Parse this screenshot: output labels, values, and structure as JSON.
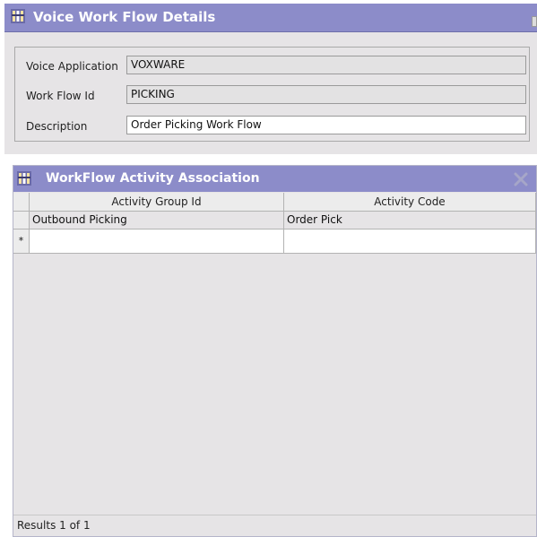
{
  "details_panel": {
    "title": "Voice Work Flow Details",
    "fields": [
      {
        "label": "Voice Application",
        "value": "VOXWARE"
      },
      {
        "label": "Work Flow Id",
        "value": "PICKING"
      },
      {
        "label": "Description",
        "value": "Order Picking Work Flow"
      }
    ]
  },
  "activity_panel": {
    "title": "WorkFlow Activity Association",
    "columns": [
      "Activity Group Id",
      "Activity Code"
    ],
    "rows": [
      {
        "activity_group_id": "Outbound Picking",
        "activity_code": "Order Pick"
      }
    ],
    "new_row_marker": "*",
    "status": "Results  1 of  1"
  },
  "colors": {
    "titlebar": "#8c8cc9",
    "panel_bg": "#e6e4e6"
  },
  "icons": [
    "workflow-app-icon",
    "close-icon"
  ]
}
